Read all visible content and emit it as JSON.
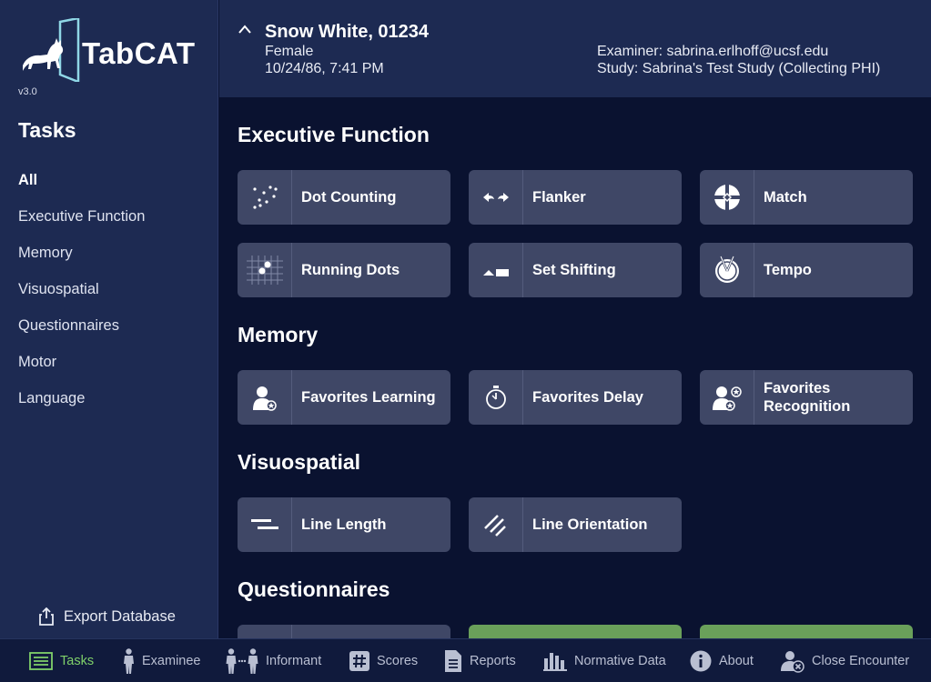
{
  "app": {
    "name": "TabCAT",
    "version": "v3.0"
  },
  "sidebar": {
    "heading": "Tasks",
    "items": [
      {
        "label": "All",
        "active": true
      },
      {
        "label": "Executive Function"
      },
      {
        "label": "Memory"
      },
      {
        "label": "Visuospatial"
      },
      {
        "label": "Questionnaires"
      },
      {
        "label": "Motor"
      },
      {
        "label": "Language"
      }
    ],
    "export_label": "Export Database"
  },
  "header": {
    "patient_name": "Snow White, 01234",
    "sex": "Female",
    "dob_time": "10/24/86, 7:41 PM",
    "examiner": "Examiner: sabrina.erlhoff@ucsf.edu",
    "study": "Study: Sabrina's Test Study (Collecting PHI)"
  },
  "sections": {
    "executive": {
      "title": "Executive Function",
      "tasks": [
        {
          "label": "Dot Counting",
          "icon": "dot-counting-icon"
        },
        {
          "label": "Flanker",
          "icon": "flanker-icon"
        },
        {
          "label": "Match",
          "icon": "match-icon"
        },
        {
          "label": "Running Dots",
          "icon": "running-dots-icon"
        },
        {
          "label": "Set Shifting",
          "icon": "set-shifting-icon"
        },
        {
          "label": "Tempo",
          "icon": "tempo-icon"
        }
      ]
    },
    "memory": {
      "title": "Memory",
      "tasks": [
        {
          "label": "Favorites Learning",
          "icon": "favorites-learning-icon"
        },
        {
          "label": "Favorites Delay",
          "icon": "stopwatch-icon"
        },
        {
          "label": "Favorites Recognition",
          "icon": "favorites-recognition-icon"
        }
      ]
    },
    "visuospatial": {
      "title": "Visuospatial",
      "tasks": [
        {
          "label": "Line Length",
          "icon": "line-length-icon"
        },
        {
          "label": "Line Orientation",
          "icon": "line-orientation-icon"
        }
      ]
    },
    "questionnaires": {
      "title": "Questionnaires"
    }
  },
  "bottom_nav": [
    {
      "label": "Tasks",
      "icon": "tasks-list-icon",
      "active": true
    },
    {
      "label": "Examinee",
      "icon": "person-icon"
    },
    {
      "label": "Informant",
      "icon": "informant-icon"
    },
    {
      "label": "Scores",
      "icon": "hash-icon"
    },
    {
      "label": "Reports",
      "icon": "document-icon"
    },
    {
      "label": "Normative Data",
      "icon": "bar-chart-icon"
    },
    {
      "label": "About",
      "icon": "info-icon"
    },
    {
      "label": "Close Encounter",
      "icon": "close-encounter-icon"
    }
  ],
  "colors": {
    "accent_green": "#7fd06a",
    "sidebar_bg": "#1d2a52",
    "main_bg": "#0a1230",
    "tile_bg": "#3f4766"
  }
}
